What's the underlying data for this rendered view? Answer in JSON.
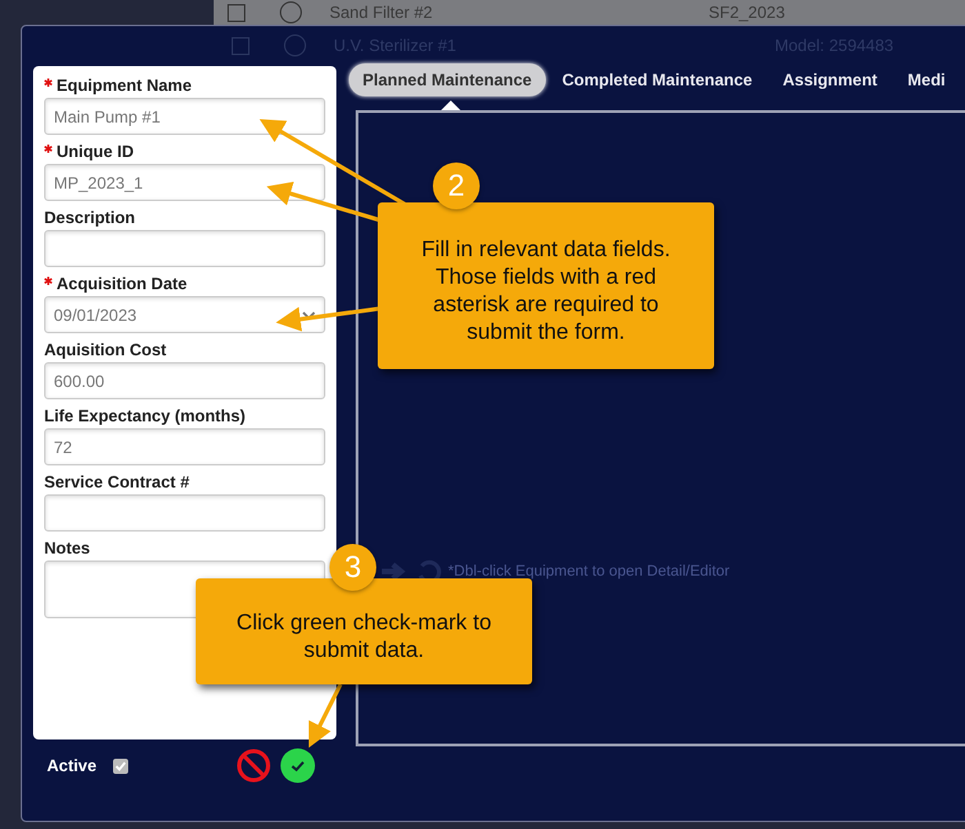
{
  "background_rows": [
    {
      "name": "Sand Filter #2",
      "detail": "SF2_2023"
    },
    {
      "name": "U.V. Sterilizer #1",
      "detail": "Model: 2594483"
    }
  ],
  "form": {
    "fields": [
      {
        "kind": "text",
        "label": "Equipment Name",
        "required": true,
        "value": "Main Pump #1"
      },
      {
        "kind": "text",
        "label": "Unique ID",
        "required": true,
        "value": "MP_2023_1"
      },
      {
        "kind": "text",
        "label": "Description",
        "required": false
      },
      {
        "kind": "date",
        "label": "Acquisition Date",
        "required": true,
        "value": "09/01/2023"
      },
      {
        "kind": "text",
        "label": "Aquisition Cost",
        "required": false,
        "value": "600.00"
      },
      {
        "kind": "text",
        "label": "Life Expectancy (months)",
        "required": false,
        "value": "72"
      },
      {
        "kind": "text",
        "label": "Service Contract #",
        "required": false
      },
      {
        "kind": "textarea",
        "label": "Notes",
        "required": false
      }
    ],
    "active": {
      "label": "Active",
      "checked": true
    }
  },
  "tabs": [
    {
      "label": "Planned Maintenance",
      "selected": true
    },
    {
      "label": "Completed Maintenance",
      "selected": false
    },
    {
      "label": "Assignment",
      "selected": false
    },
    {
      "label": "Medi",
      "selected": false
    }
  ],
  "empty_hint": "*Dbl-click Equipment to open Detail/Editor",
  "callouts": [
    {
      "number": "2",
      "text": "Fill in relevant data fields. Those fields with a red asterisk are required to submit the form."
    },
    {
      "number": "3",
      "text": "Click green check-mark to submit data."
    }
  ]
}
